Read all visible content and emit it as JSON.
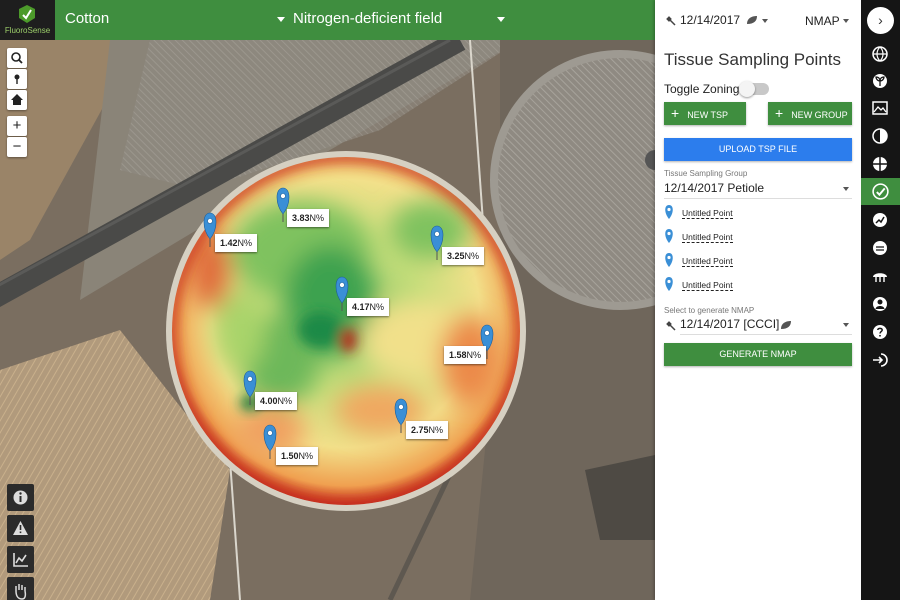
{
  "app": {
    "logo_text": "FluoroSense"
  },
  "topbar": {
    "crop": "Cotton",
    "field": "Nitrogen-deficient field"
  },
  "map": {
    "controls": [
      "search-icon",
      "pin-icon",
      "home-icon",
      "zoom-in",
      "zoom-out"
    ],
    "zoom_in_label": "+",
    "zoom_out_label": "−",
    "points": [
      {
        "value": "1.42",
        "unit": "N%"
      },
      {
        "value": "3.83",
        "unit": "N%"
      },
      {
        "value": "3.25",
        "unit": "N%"
      },
      {
        "value": "4.17",
        "unit": "N%"
      },
      {
        "value": "1.58",
        "unit": "N%"
      },
      {
        "value": "4.00",
        "unit": "N%"
      },
      {
        "value": "2.75",
        "unit": "N%"
      },
      {
        "value": "1.50",
        "unit": "N%"
      }
    ],
    "tools": [
      "info-icon",
      "warning-icon",
      "chart-icon",
      "hand-icon"
    ]
  },
  "panel": {
    "date": "12/14/2017",
    "mode": "NMAP",
    "title": "Tissue Sampling Points",
    "toggle_label": "Toggle Zoning",
    "toggle_on": false,
    "new_tsp": "NEW TSP",
    "new_group": "NEW GROUP",
    "upload": "UPLOAD TSP FILE",
    "group_label": "Tissue Sampling Group",
    "group_value": "12/14/2017 Petiole",
    "points": [
      "Untitled Point",
      "Untitled Point",
      "Untitled Point",
      "Untitled Point"
    ],
    "nmap_label": "Select to generate NMAP",
    "nmap_value": "12/14/2017 [CCCI]",
    "generate": "GENERATE NMAP"
  },
  "nav": {
    "expand_label": "›",
    "icons": [
      "globe-icon",
      "plant-icon",
      "image-icon",
      "half-circle-icon",
      "crosshair-icon",
      "check-circle-icon",
      "trend-icon",
      "face-icon",
      "canopy-icon",
      "user-icon",
      "help-icon",
      "logout-icon"
    ],
    "active": "check-circle-icon"
  },
  "colors": {
    "primary_green": "#3f8e3f",
    "accent_blue": "#2c7ded",
    "pin_blue": "#3a8fd6"
  }
}
